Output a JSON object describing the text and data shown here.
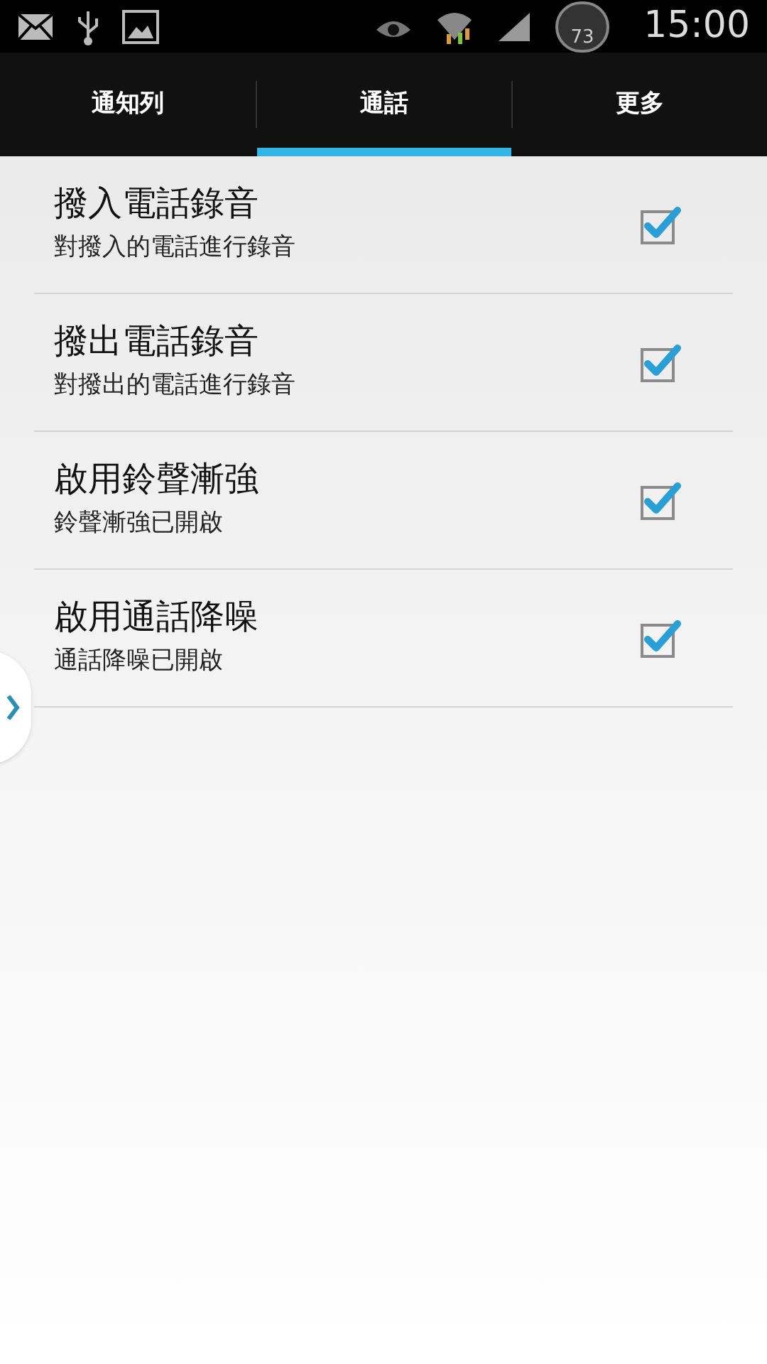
{
  "status_bar": {
    "gauge_reading": "73",
    "time": "15:00"
  },
  "tabs": [
    {
      "label": "通知列",
      "selected": false
    },
    {
      "label": "通話",
      "selected": true
    },
    {
      "label": "更多",
      "selected": false
    }
  ],
  "settings": [
    {
      "title": "撥入電話錄音",
      "summary": "對撥入的電話進行錄音",
      "checked": true
    },
    {
      "title": "撥出電話錄音",
      "summary": "對撥出的電話進行錄音",
      "checked": true
    },
    {
      "title": "啟用鈴聲漸強",
      "summary": "鈴聲漸強已開啟",
      "checked": true
    },
    {
      "title": "啟用通話降噪",
      "summary": "通話降噪已開啟",
      "checked": true
    }
  ]
}
